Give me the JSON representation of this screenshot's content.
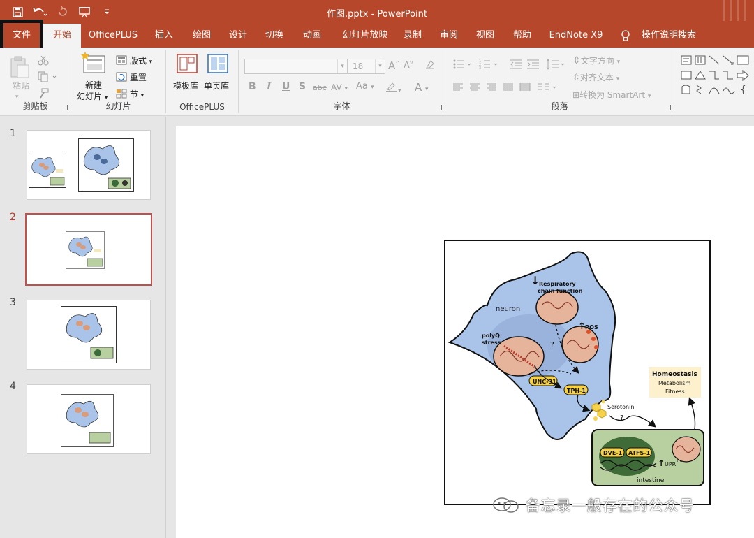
{
  "titlebar": {
    "document_title": "作图.pptx - PowerPoint",
    "qat": [
      "save-icon",
      "undo-icon",
      "redo-icon",
      "presentation-icon",
      "customize-icon"
    ]
  },
  "tabs": [
    "文件",
    "开始",
    "OfficePLUS",
    "插入",
    "绘图",
    "设计",
    "切换",
    "动画",
    "幻灯片放映",
    "录制",
    "审阅",
    "视图",
    "帮助",
    "EndNote X9",
    "操作说明搜索"
  ],
  "active_tab": "开始",
  "ribbon": {
    "clipboard": {
      "label": "剪贴板",
      "paste": "粘贴"
    },
    "slides": {
      "label": "幻灯片",
      "new_slide": "新建",
      "new_slide_2": "幻灯片",
      "layout": "版式",
      "reset": "重置",
      "section": "节"
    },
    "officeplus": {
      "label": "OfficePLUS",
      "template": "模板库",
      "single_page": "单页库"
    },
    "font": {
      "label": "字体",
      "font_size": "18",
      "bold": "B",
      "italic": "I",
      "underline": "U",
      "shadow": "S",
      "strike": "abc",
      "spacing": "AV",
      "case": "Aa",
      "color": "A"
    },
    "paragraph": {
      "label": "段落",
      "text_direction": "文字方向",
      "align_text": "对齐文本",
      "smartart": "转换为 SmartArt"
    }
  },
  "slides": [
    {
      "number": "1"
    },
    {
      "number": "2"
    },
    {
      "number": "3"
    },
    {
      "number": "4"
    }
  ],
  "figure": {
    "respiratory": "Respiratory",
    "chain_function": "chain function",
    "neuron": "neuron",
    "polyq": "polyQ",
    "stress": "stress",
    "ros": "ROS",
    "unc31": "UNC-31",
    "tph1": "TPH-1",
    "serotonin": "Serotonin",
    "question": "?",
    "homeostasis": "Homeostasis",
    "metabolism": "Metabolism",
    "fitness": "Fitness",
    "dve1": "DVE-1",
    "atfs1": "ATFS-1",
    "upr": "UPR",
    "upr_sup": "mt",
    "intestine": "intestine"
  },
  "watermark": "备忘录一般存在的公众号",
  "colors": {
    "accent": "#b7472a",
    "neuron": "#a9c4e8",
    "intestine": "#b8d0a0",
    "tag": "#f6d24a"
  }
}
